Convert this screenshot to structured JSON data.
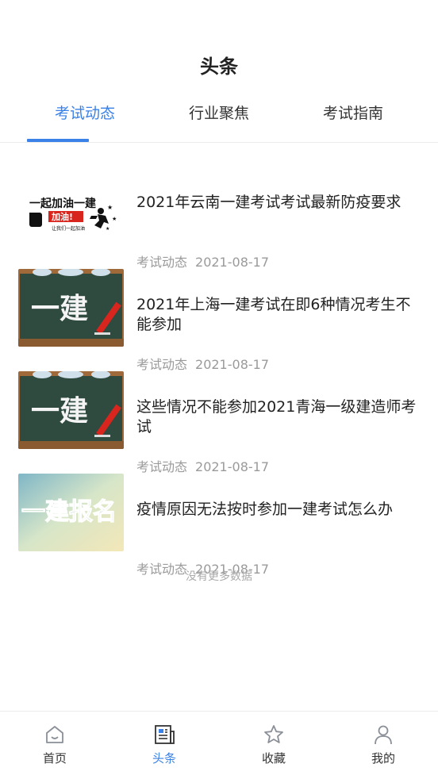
{
  "header": {
    "title": "头条"
  },
  "tabs": [
    {
      "label": "考试动态",
      "active": true
    },
    {
      "label": "行业聚焦",
      "active": false
    },
    {
      "label": "考试指南",
      "active": false
    }
  ],
  "articles": [
    {
      "title": "2021年云南一建考试考试最新防疫要求",
      "category": "考试动态",
      "date": "2021-08-17",
      "thumb_text": [
        "一起加油一建",
        "加油!",
        "让我们一起加油"
      ],
      "thumb_icon": "fist-runner-banner"
    },
    {
      "title": "2021年上海一建考试在即6种情况考生不能参加",
      "category": "考试动态",
      "date": "2021-08-17",
      "thumb_text": [
        "一建"
      ],
      "thumb_icon": "chalkboard-image"
    },
    {
      "title": "这些情况不能参加2021青海一级建造师考试",
      "category": "考试动态",
      "date": "2021-08-17",
      "thumb_text": [
        "一建"
      ],
      "thumb_icon": "chalkboard-image"
    },
    {
      "title": "疫情原因无法按时参加一建考试怎么办",
      "category": "考试动态",
      "date": "2021-08-17",
      "thumb_text": [
        "一建报名"
      ],
      "thumb_icon": "registration-banner"
    }
  ],
  "list_footer": "没有更多数据",
  "tabbar": [
    {
      "label": "首页",
      "icon": "home-icon",
      "active": false
    },
    {
      "label": "头条",
      "icon": "news-icon",
      "active": true
    },
    {
      "label": "收藏",
      "icon": "star-icon",
      "active": false
    },
    {
      "label": "我的",
      "icon": "user-icon",
      "active": false
    }
  ],
  "colors": {
    "accent": "#3a82e8",
    "meta": "#9a9a9a",
    "chalkboard": "#2f4a3f",
    "frame": "#a0693a"
  }
}
